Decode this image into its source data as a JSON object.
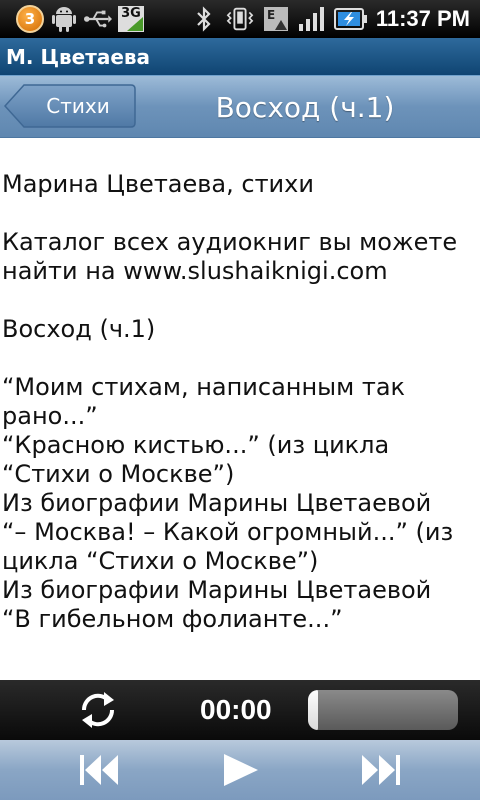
{
  "statusbar": {
    "notification_count": "3",
    "network_type": "3G",
    "data_type": "E",
    "time": "11:37 PM",
    "icons": [
      "notification-badge",
      "android-icon",
      "usb-icon",
      "3g-icon",
      "bluetooth-icon",
      "vibrate-icon",
      "edge-icon",
      "signal-icon",
      "battery-charging-icon"
    ]
  },
  "app": {
    "title": "М. Цветаева"
  },
  "navbar": {
    "back_label": "Стихи",
    "title": "Восход (ч.1)"
  },
  "content": {
    "paragraphs": [
      [
        "Марина Цветаева, стихи"
      ],
      [
        "Каталог всех аудиокниг вы можете",
        "найти на www.slushaiknigi.com"
      ],
      [
        "Восход (ч.1)"
      ],
      [
        "“Моим стихам, написанным так",
        "рано...”",
        "“Красною кистью...” (из цикла",
        "“Стихи о Москве”)",
        "Из биографии Марины Цветаевой",
        "“– Москва! – Какой огромный...” (из",
        "цикла “Стихи о Москве”)",
        "Из биографии Марины Цветаевой",
        "“В гибельном фолианте...”"
      ]
    ]
  },
  "player": {
    "time": "00:00",
    "progress": 0.0
  },
  "colors": {
    "title_bar": "#1f5789",
    "nav_bar": "#7a9ec4",
    "controls_bar": "#8aa6c5"
  }
}
